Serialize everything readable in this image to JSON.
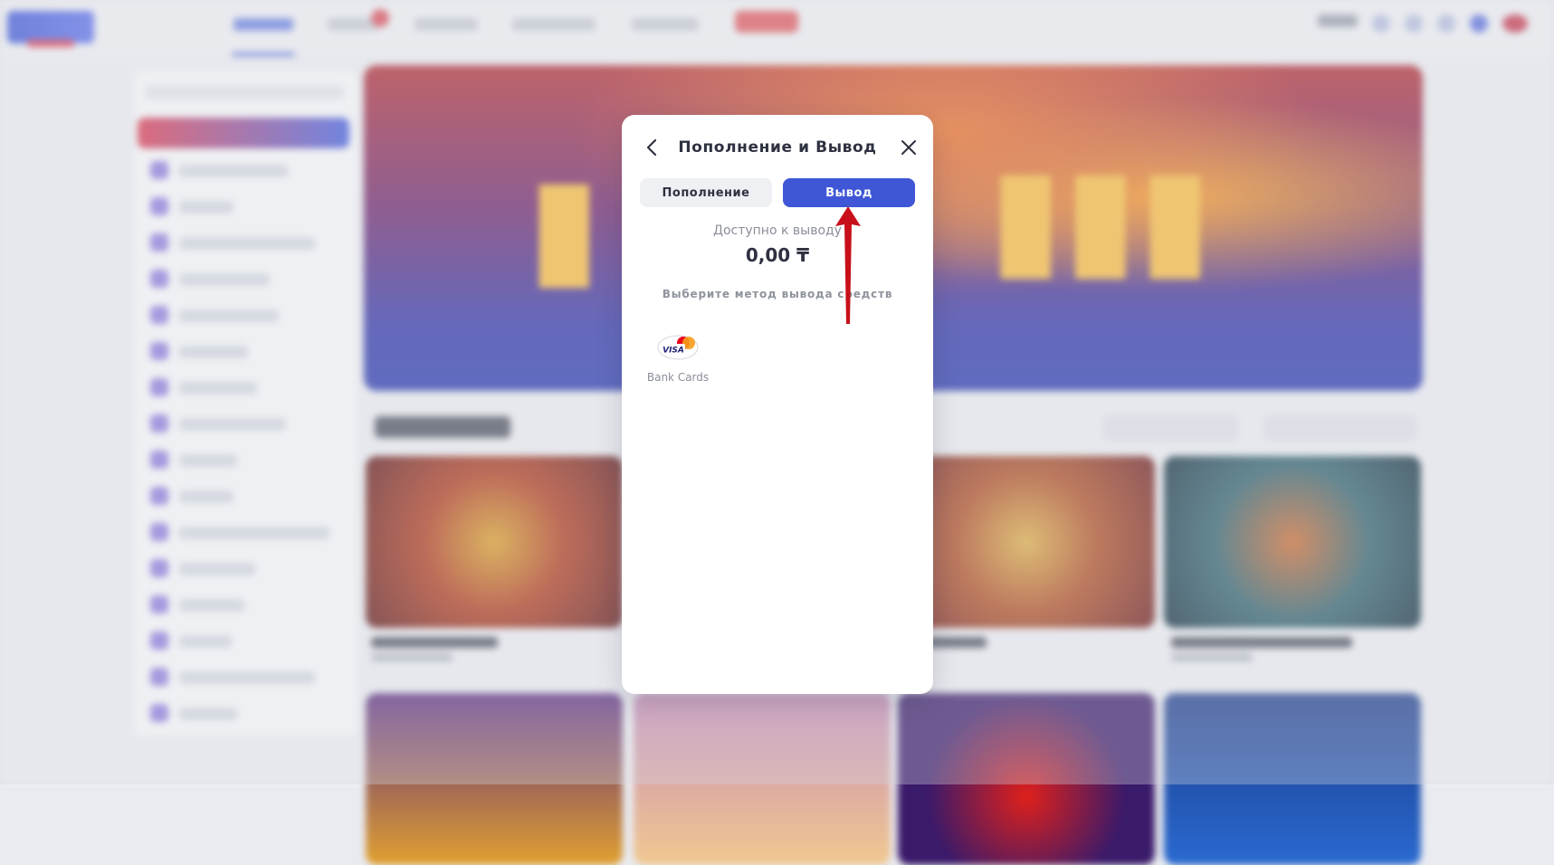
{
  "modal": {
    "title": "Пополнение и Вывод",
    "back_icon": "chevron-left-icon",
    "close_icon": "close-icon",
    "tabs": [
      {
        "label": "Пополнение",
        "active": false
      },
      {
        "label": "Вывод",
        "active": true
      }
    ],
    "available_label": "Доступно к выводу",
    "available_amount": "0,00 ₸",
    "method_hint": "Выберите метод вывода средств",
    "methods": [
      {
        "label": "Bank Cards",
        "icon": "visa-mastercard-icon"
      }
    ]
  },
  "annotation": {
    "type": "arrow",
    "color": "#c8101a",
    "points_to": "Вывод"
  },
  "colors": {
    "accent": "#3f57d6",
    "tab_inactive_bg": "#eef0f4",
    "text_dark": "#2e3140",
    "text_muted": "#8a8e99"
  }
}
